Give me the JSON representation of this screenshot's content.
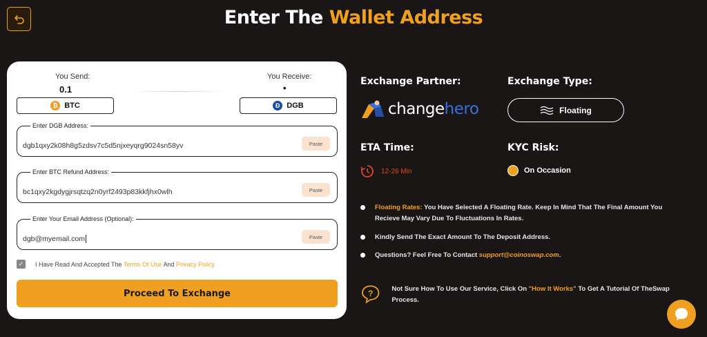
{
  "header": {
    "title_prefix": "Enter The",
    "title_accent": "Wallet Address"
  },
  "exchange_card": {
    "send_label": "You Send:",
    "send_amount": "0.1",
    "receive_label": "You Receive:",
    "receive_amount": "•",
    "send_coin": "BTC",
    "receive_coin": "DGB"
  },
  "fields": {
    "dgb_address": {
      "label": "Enter DGB Address:",
      "value": "dgb1qxy2k08h8g5zdsv7c5d5njxeyqrg9024sn58yv",
      "paste_label": "Paste"
    },
    "btc_refund": {
      "label": "Enter BTC Refund Address:",
      "value": "bc1qxy2kgdygjrsqtzq2n0yrf2493p83kkfjhx0wlh",
      "paste_label": "Paste"
    },
    "email": {
      "label": "Enter Your Email Address (Optional):",
      "value": "dgb@myemail.com",
      "paste_label": "Paste"
    }
  },
  "terms": {
    "prefix": "I Have Read And Accepted The",
    "terms_link": "Terms Of Use",
    "and": "And",
    "privacy_link": "Privacy Policy",
    "checked": true
  },
  "proceed_label": "Proceed To Exchange",
  "info": {
    "partner_label": "Exchange Partner:",
    "partner_name_a": "change",
    "partner_name_b": "hero",
    "type_label": "Exchange Type:",
    "type_value": "Floating",
    "eta_label": "ETA Time:",
    "eta_value": "12-26 Min",
    "kyc_label": "KYC Risk:",
    "kyc_value": "On Occasion"
  },
  "notes": {
    "n1_highlight": "Floating Rates:",
    "n1_text": "You Have Selected A Floating Rate. Keep In Mind That The Final Amount You Recieve May Vary Due To Fluctuations In Rates.",
    "n2_text": "Kindly Send The Exact Amount To The Deposit Address.",
    "n3_text": "Questions? Feel Free To Contact",
    "n3_email": "support@coinoswap.com",
    "n3_end": "."
  },
  "howto": {
    "prefix": "Not Sure How To Use Our Service, Click On",
    "link": "\"How It Works\"",
    "suffix": "To Get A Tutorial Of TheSwap Process."
  },
  "colors": {
    "accent": "#f0a020",
    "background": "#1b1616",
    "eta": "#e24a1e"
  }
}
